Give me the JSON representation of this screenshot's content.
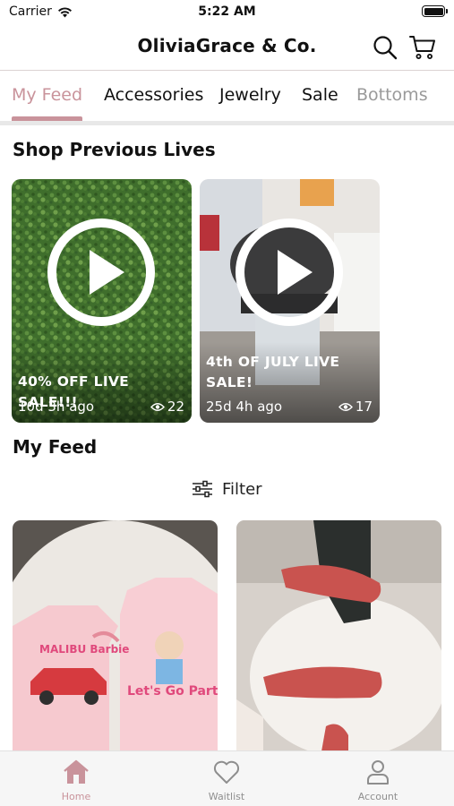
{
  "status_bar": {
    "carrier": "Carrier",
    "time": "5:22 AM",
    "battery_level": 1.0
  },
  "header": {
    "title": "OliviaGrace & Co."
  },
  "tabs": [
    {
      "label": "My Feed",
      "active": true
    },
    {
      "label": "Accessories",
      "active": false
    },
    {
      "label": "Jewelry",
      "active": false
    },
    {
      "label": "Sale",
      "active": false
    },
    {
      "label": "Bottoms",
      "active": false
    }
  ],
  "previous_lives": {
    "title": "Shop Previous Lives",
    "items": [
      {
        "title": "40% OFF LIVE SALE!!!",
        "age": "10d 3h ago",
        "views": "22"
      },
      {
        "title": "4th OF JULY LIVE SALE!",
        "age": "25d 4h ago",
        "views": "17"
      }
    ]
  },
  "feed": {
    "title": "My Feed",
    "filter_label": "Filter"
  },
  "products": [
    {
      "graphic_text_left": "MALIBU Barbie",
      "graphic_text_right": "Let's Go Party"
    },
    {
      "graphic_text": ""
    }
  ],
  "bottom_nav": [
    {
      "label": "Home",
      "active": true
    },
    {
      "label": "Waitlist",
      "active": false
    },
    {
      "label": "Account",
      "active": false
    }
  ],
  "colors": {
    "accent": "#c9939b",
    "inactive": "#8e8e8e"
  }
}
